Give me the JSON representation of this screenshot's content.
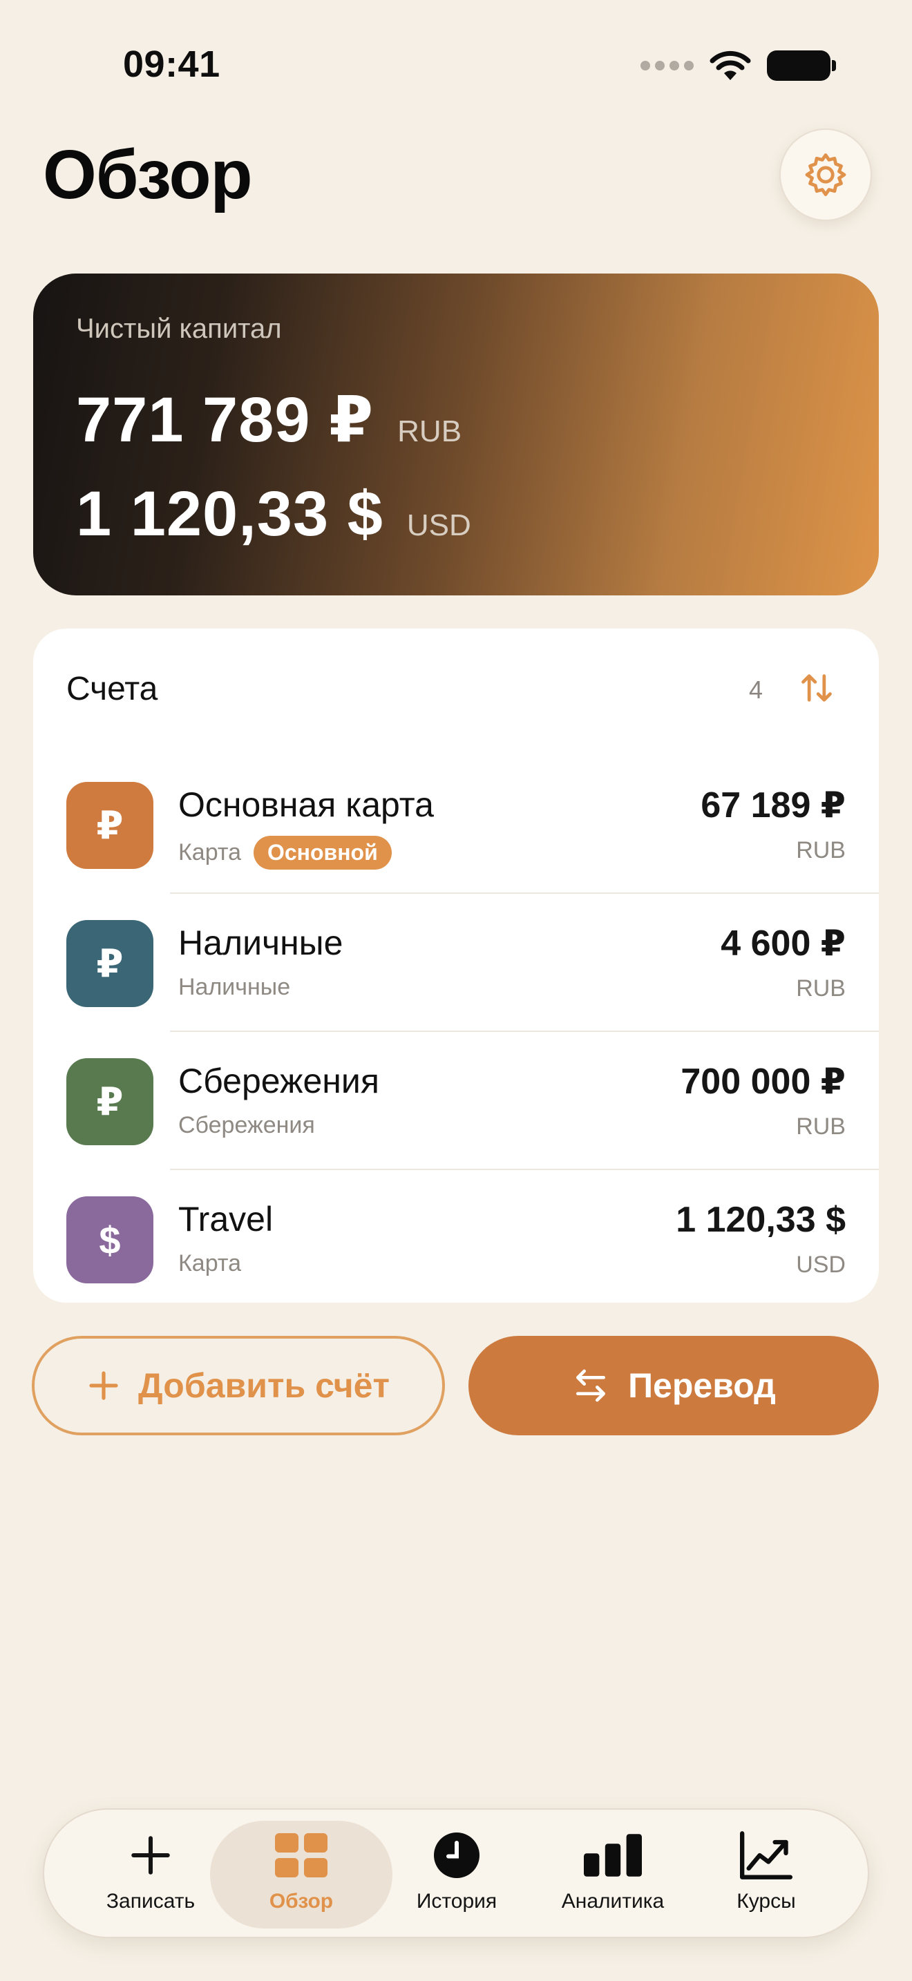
{
  "status": {
    "time": "09:41"
  },
  "header": {
    "title": "Обзор"
  },
  "net_worth": {
    "label": "Чистый капитал",
    "rows": [
      {
        "amount": "771 789 ₽",
        "currency": "RUB"
      },
      {
        "amount": "1 120,33 $",
        "currency": "USD"
      }
    ]
  },
  "accounts": {
    "title": "Счета",
    "count": "4",
    "items": [
      {
        "symbol": "₽",
        "color": "#cf7a3f",
        "name": "Основная карта",
        "type": "Карта",
        "badge": "Основной",
        "amount": "67 189 ₽",
        "currency": "RUB"
      },
      {
        "symbol": "₽",
        "color": "#3a6676",
        "name": "Наличные",
        "type": "Наличные",
        "badge": "",
        "amount": "4 600 ₽",
        "currency": "RUB"
      },
      {
        "symbol": "₽",
        "color": "#587a4e",
        "name": "Сбережения",
        "type": "Сбережения",
        "badge": "",
        "amount": "700 000 ₽",
        "currency": "RUB"
      },
      {
        "symbol": "$",
        "color": "#8a6a9c",
        "name": "Travel",
        "type": "Карта",
        "badge": "",
        "amount": "1 120,33 $",
        "currency": "USD"
      }
    ]
  },
  "actions": {
    "add_label": "Добавить счёт",
    "transfer_label": "Перевод"
  },
  "tabs": [
    {
      "label": "Записать",
      "icon": "plus-icon"
    },
    {
      "label": "Обзор",
      "icon": "grid-icon"
    },
    {
      "label": "История",
      "icon": "clock-icon"
    },
    {
      "label": "Аналитика",
      "icon": "bar-chart-icon"
    },
    {
      "label": "Курсы",
      "icon": "trend-chart-icon"
    }
  ],
  "colors": {
    "accent": "#e0924a",
    "background": "#f5efe5"
  }
}
